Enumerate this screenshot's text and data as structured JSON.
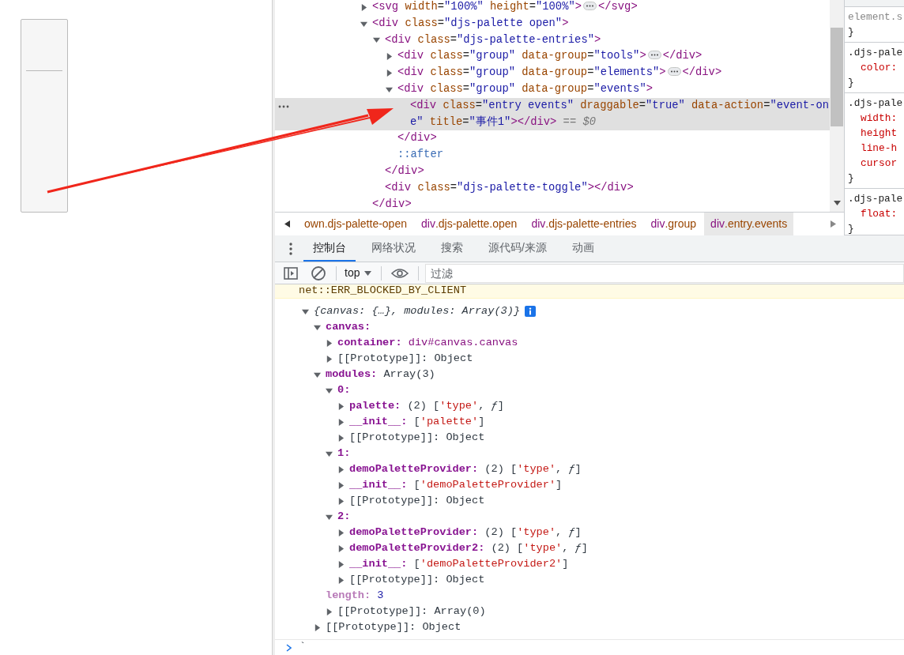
{
  "elements": {
    "tree": [
      {
        "kind": "element",
        "open": "<svg width=\"100%\" height=\"100%\">",
        "close": "</svg>",
        "expanded": false,
        "selected": false
      },
      {
        "kind": "element",
        "open": "<div class=\"djs-palette open\">",
        "close": "</div>",
        "expanded": true,
        "selected": false,
        "children": [
          {
            "kind": "element",
            "open": "<div class=\"djs-palette-entries\">",
            "close": "</div>",
            "expanded": true,
            "selected": false,
            "children": [
              {
                "kind": "element",
                "open": "<div class=\"group\" data-group=\"tools\">",
                "close": "</div>",
                "expanded": false,
                "selected": false
              },
              {
                "kind": "element",
                "open": "<div class=\"group\" data-group=\"elements\">",
                "close": "</div>",
                "expanded": false,
                "selected": false
              },
              {
                "kind": "element",
                "open": "<div class=\"group\" data-group=\"events\">",
                "close": "</div>",
                "expanded": true,
                "selected": false,
                "children": [
                  {
                    "kind": "element",
                    "open": "<div class=\"entry events\" draggable=\"true\" data-action=\"event-one\" title=\"事件1\"></div>",
                    "selected": true,
                    "suffix": "== $0"
                  }
                ]
              },
              {
                "kind": "pseudo",
                "open": "::after",
                "selected": false
              }
            ]
          },
          {
            "kind": "element",
            "open": "<div class=\"djs-palette-toggle\"></div>",
            "selected": false
          }
        ]
      }
    ],
    "breadcrumbs": [
      {
        "rest": "own.djs-palette-open",
        "selected": false
      },
      {
        "tag": "div",
        "rest": ".djs-palette.open",
        "selected": false
      },
      {
        "tag": "div",
        "rest": ".djs-palette-entries",
        "selected": false
      },
      {
        "tag": "div",
        "rest": ".group",
        "selected": false
      },
      {
        "tag": "div",
        "rest": ".entry.events",
        "selected": true
      }
    ],
    "styles": [
      {
        "selector": "element.s",
        "close": "}"
      },
      {
        "selector": ".djs-pale",
        "props": [
          "color:"
        ],
        "close": "}"
      },
      {
        "selector": ".djs-pale",
        "props": [
          "width:",
          "height",
          "line-h",
          "cursor"
        ],
        "close": "}"
      },
      {
        "selector": ".djs-pale",
        "props": [
          "float:"
        ],
        "close": "}"
      }
    ]
  },
  "drawer_tabs": [
    {
      "label": "控制台",
      "selected": true
    },
    {
      "label": "网络状况",
      "selected": false
    },
    {
      "label": "搜索",
      "selected": false
    },
    {
      "label": "源代码/来源",
      "selected": false
    },
    {
      "label": "动画",
      "selected": false
    }
  ],
  "console": {
    "context": "top",
    "filter": {
      "placeholder": "过滤"
    },
    "warning": "net::ERR_BLOCKED_BY_CLIENT",
    "object": {
      "summary": "{canvas: {…}, modules: Array(3)}",
      "expanded": true,
      "children": [
        {
          "key": "canvas:",
          "kind": "own",
          "expanded": true,
          "children": [
            {
              "key": "container:",
              "value": {
                "kind": "node",
                "text": "div#canvas.canvas"
              },
              "kind": "own",
              "expanded": false
            },
            {
              "key": "[[Prototype]]:",
              "value": "Object",
              "kind": "internal",
              "expanded": false
            }
          ]
        },
        {
          "key": "modules:",
          "value": "Array(3)",
          "kind": "own",
          "expanded": true,
          "children": [
            {
              "key": "0:",
              "kind": "own",
              "expanded": true,
              "children": [
                {
                  "key": "palette:",
                  "value": "(2) ['type', ƒ]",
                  "kind": "own",
                  "expanded": false
                },
                {
                  "key": "__init__:",
                  "value": "['palette']",
                  "kind": "own",
                  "expanded": false
                },
                {
                  "key": "[[Prototype]]:",
                  "value": "Object",
                  "kind": "internal",
                  "expanded": false
                }
              ]
            },
            {
              "key": "1:",
              "kind": "own",
              "expanded": true,
              "children": [
                {
                  "key": "demoPaletteProvider:",
                  "value": "(2) ['type', ƒ]",
                  "kind": "own",
                  "expanded": false
                },
                {
                  "key": "__init__:",
                  "value": "['demoPaletteProvider']",
                  "kind": "own",
                  "expanded": false
                },
                {
                  "key": "[[Prototype]]:",
                  "value": "Object",
                  "kind": "internal",
                  "expanded": false
                }
              ]
            },
            {
              "key": "2:",
              "kind": "own",
              "expanded": true,
              "children": [
                {
                  "key": "demoPaletteProvider:",
                  "value": "(2) ['type', ƒ]",
                  "kind": "own",
                  "expanded": false
                },
                {
                  "key": "demoPaletteProvider2:",
                  "value": "(2) ['type', ƒ]",
                  "kind": "own",
                  "expanded": false
                },
                {
                  "key": "__init__:",
                  "value": "['demoPaletteProvider2']",
                  "kind": "own",
                  "expanded": false
                },
                {
                  "key": "[[Prototype]]:",
                  "value": "Object",
                  "kind": "internal",
                  "expanded": false
                }
              ]
            },
            {
              "key": "length:",
              "value": {
                "kind": "number",
                "text": "3"
              },
              "kind": "nonenum"
            },
            {
              "key": "[[Prototype]]:",
              "value": "Array(0)",
              "kind": "internal",
              "expanded": false
            }
          ]
        },
        {
          "key": "[[Prototype]]:",
          "value": "Object",
          "kind": "internal",
          "expanded": false
        }
      ]
    },
    "prompt_value": "`"
  }
}
